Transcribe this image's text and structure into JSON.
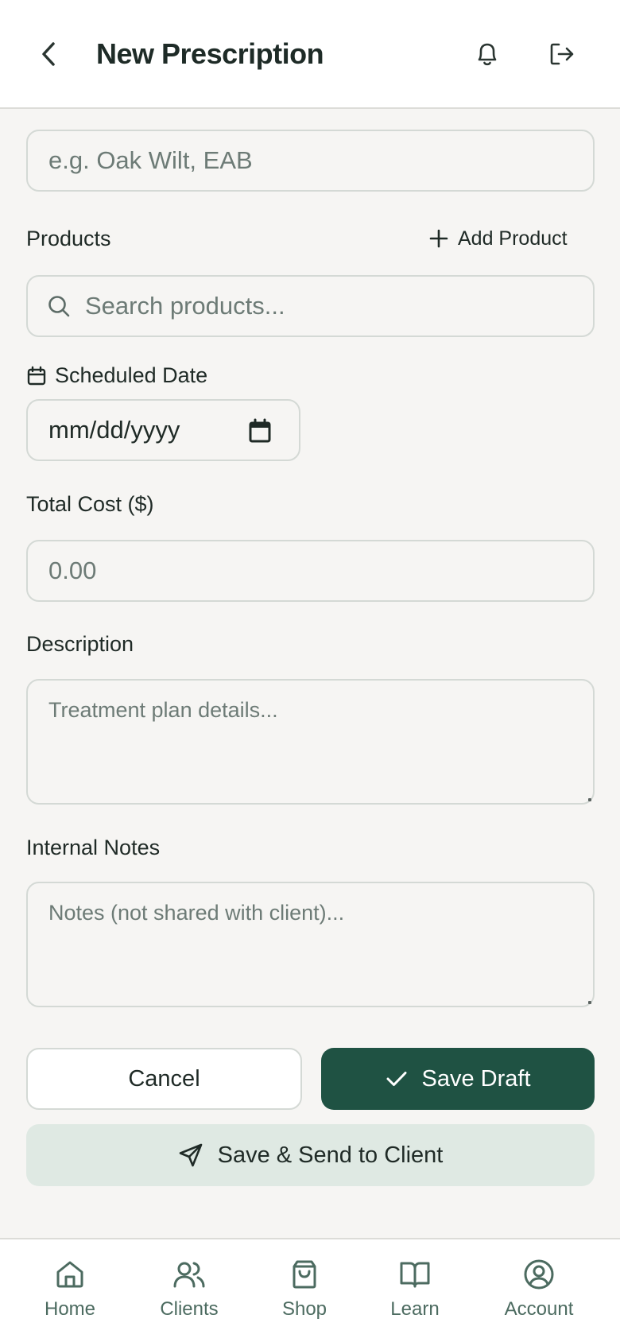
{
  "header": {
    "title": "New Prescription",
    "back_icon": "chevron-left-icon",
    "bell_icon": "bell-icon",
    "logout_icon": "logout-icon"
  },
  "form": {
    "issue_input": {
      "placeholder": "e.g. Oak Wilt, EAB"
    },
    "products": {
      "label": "Products",
      "add_label": "Add Product",
      "search_placeholder": "Search products..."
    },
    "scheduled_date": {
      "label": "Scheduled Date",
      "value": "mm/dd/yyyy"
    },
    "total_cost": {
      "label": "Total Cost ($)",
      "placeholder": "0.00"
    },
    "description": {
      "label": "Description",
      "placeholder": "Treatment plan details..."
    },
    "internal_notes": {
      "label": "Internal Notes",
      "placeholder": "Notes (not shared with client)..."
    }
  },
  "actions": {
    "cancel_label": "Cancel",
    "save_draft_label": "Save Draft",
    "send_label": "Save & Send to Client"
  },
  "nav": {
    "items": [
      {
        "label": "Home",
        "icon": "home-icon"
      },
      {
        "label": "Clients",
        "icon": "users-icon"
      },
      {
        "label": "Shop",
        "icon": "shopping-bag-icon"
      },
      {
        "label": "Learn",
        "icon": "book-icon"
      },
      {
        "label": "Account",
        "icon": "user-circle-icon"
      }
    ]
  },
  "colors": {
    "primary": "#1f5243",
    "primary_soft": "#dfe9e3",
    "background": "#f6f5f3",
    "nav_text": "#4c6b60"
  }
}
